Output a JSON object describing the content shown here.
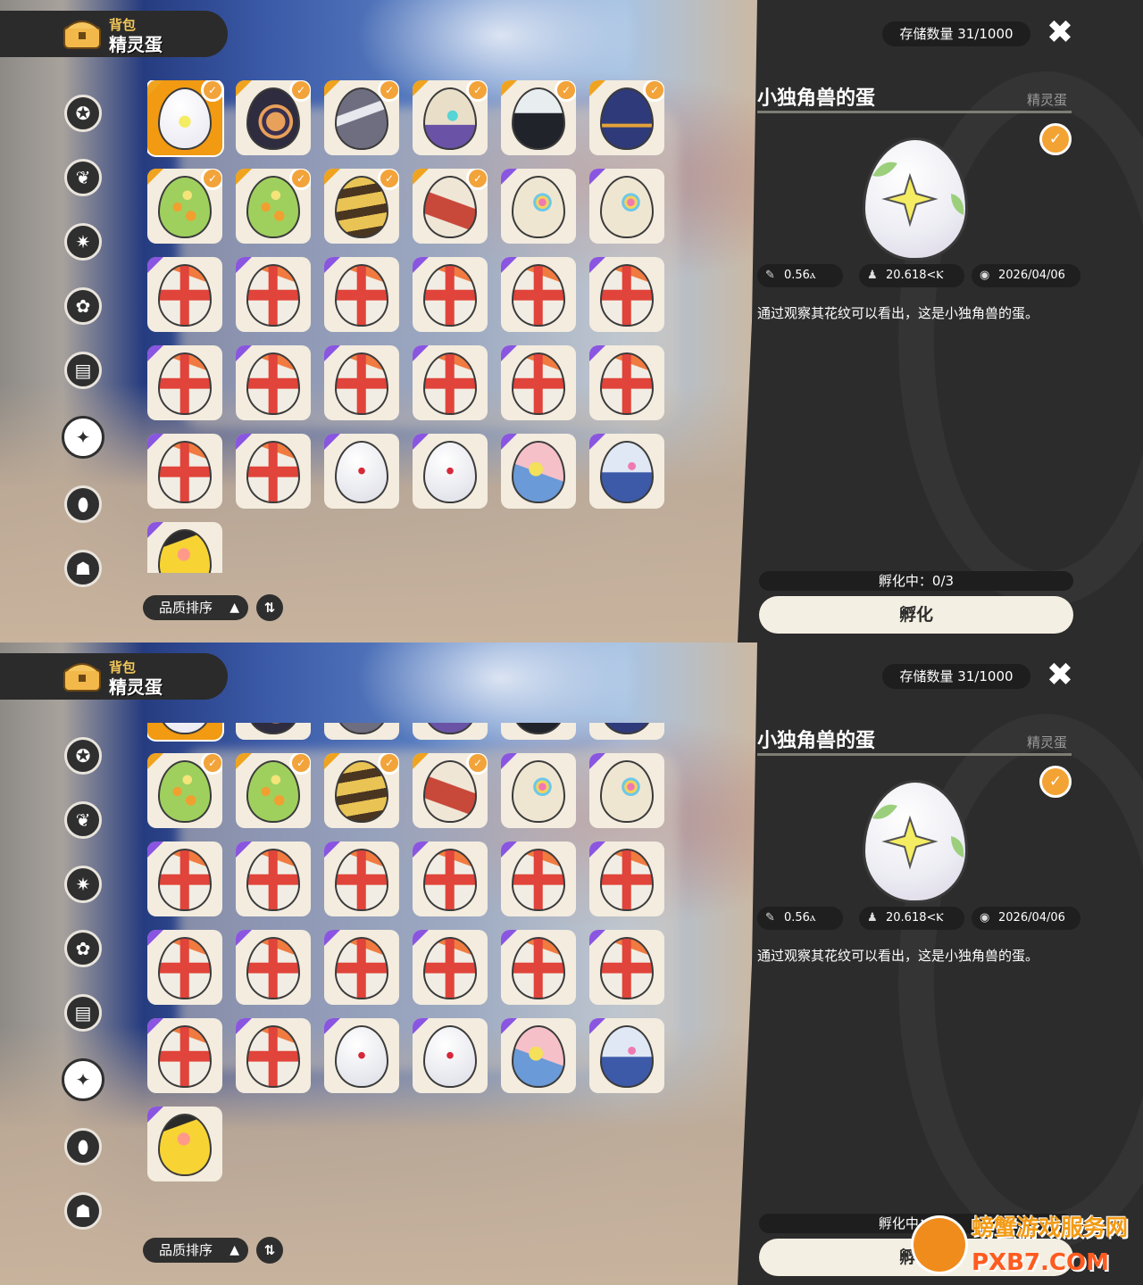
{
  "header": {
    "subtitle": "背包",
    "title": "精灵蛋"
  },
  "sidebar": {
    "items": [
      {
        "icon": "star-badge-icon"
      },
      {
        "icon": "leaf-icon"
      },
      {
        "icon": "sparkle-badge-icon"
      },
      {
        "icon": "plant-icon"
      },
      {
        "icon": "card-icon"
      },
      {
        "icon": "egg-icon",
        "active": true
      },
      {
        "icon": "acorn-icon"
      },
      {
        "icon": "bag-icon"
      }
    ]
  },
  "sort": {
    "label": "品质排序",
    "arrow": "▲",
    "toggle": "⇅"
  },
  "panel": {
    "storage": "存储数量 31/1000",
    "close": "✖",
    "title": "小独角兽的蛋",
    "category": "精灵蛋",
    "stats": {
      "size": "0.56ⲁ",
      "weight": "20.618<Ⲕ",
      "date": "2026/04/06"
    },
    "description": "通过观察其花纹可以看出，这是小独角兽的蛋。",
    "hatching": "孵化中：0/3",
    "hatch_button": "孵化"
  },
  "eggs": [
    {
      "style": "sparkle",
      "tri": "orange",
      "medal": true,
      "selected": true
    },
    {
      "style": "flame",
      "tri": "orange",
      "medal": true
    },
    {
      "style": "zig",
      "tri": "orange",
      "medal": true
    },
    {
      "style": "tri",
      "tri": "orange",
      "medal": true
    },
    {
      "style": "spike",
      "tri": "orange",
      "medal": true
    },
    {
      "style": "wave",
      "tri": "orange",
      "medal": true
    },
    {
      "style": "spot",
      "tri": "orange",
      "medal": true
    },
    {
      "style": "spot",
      "tri": "orange",
      "medal": true
    },
    {
      "style": "stripe",
      "tri": "orange",
      "medal": true
    },
    {
      "style": "red",
      "tri": "orange",
      "medal": true
    },
    {
      "style": "rainbow",
      "tri": "purple",
      "medal": false
    },
    {
      "style": "rainbow",
      "tri": "purple",
      "medal": false
    },
    {
      "style": "cross",
      "tri": "purple"
    },
    {
      "style": "cross",
      "tri": "purple"
    },
    {
      "style": "cross",
      "tri": "purple"
    },
    {
      "style": "cross",
      "tri": "purple"
    },
    {
      "style": "cross",
      "tri": "purple"
    },
    {
      "style": "cross",
      "tri": "purple"
    },
    {
      "style": "cross",
      "tri": "purple"
    },
    {
      "style": "cross",
      "tri": "purple"
    },
    {
      "style": "cross",
      "tri": "purple"
    },
    {
      "style": "cross",
      "tri": "purple"
    },
    {
      "style": "cross",
      "tri": "purple"
    },
    {
      "style": "cross",
      "tri": "purple"
    },
    {
      "style": "cross",
      "tri": "purple"
    },
    {
      "style": "cross",
      "tri": "purple"
    },
    {
      "style": "dot",
      "tri": "purple"
    },
    {
      "style": "dot",
      "tri": "purple"
    },
    {
      "style": "star",
      "tri": "purple"
    },
    {
      "style": "blue",
      "tri": "purple"
    },
    {
      "style": "yellow",
      "tri": "purple"
    }
  ],
  "watermark": {
    "name": "螃蟹游戏服务网",
    "url": "PXB7.COM"
  },
  "colors": {
    "accent": "#f19a12",
    "panel": "#2c2c2c",
    "card": "#f3ecdf",
    "purple": "#8a55e0"
  }
}
